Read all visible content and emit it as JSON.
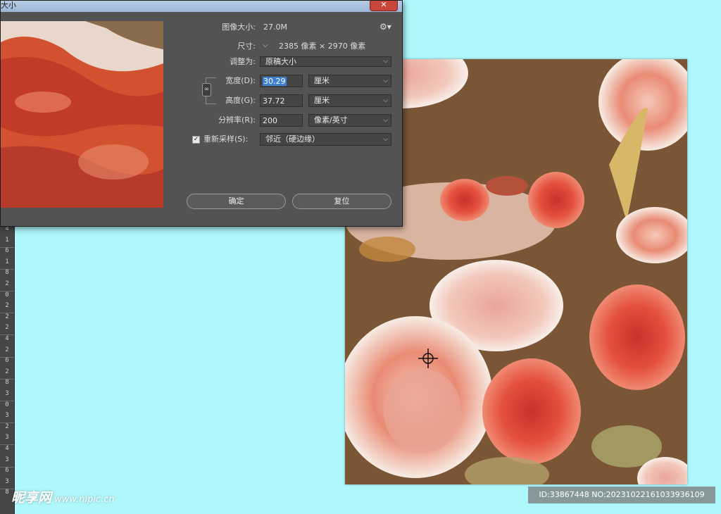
{
  "window": {
    "title": "大小",
    "close_label": "✕"
  },
  "dialog": {
    "image_size_label": "图像大小:",
    "image_size_value": "27.0M",
    "dimensions_label": "尺寸:",
    "dimensions_value": "2385 像素 × 2970 像素",
    "fit_label": "调整为:",
    "fit_value": "原稿大小",
    "width_label": "宽度(D):",
    "width_value": "30.29",
    "width_unit": "厘米",
    "height_label": "高度(G):",
    "height_value": "37.72",
    "height_unit": "厘米",
    "resolution_label": "分辨率(R):",
    "resolution_value": "200",
    "resolution_unit": "像素/英寸",
    "resample_label": "重新采样(S):",
    "resample_value": "邻近（硬边缘）",
    "ok_label": "确定",
    "reset_label": "复位"
  },
  "ruler": {
    "ticks": [
      "4",
      "1",
      "6",
      "1",
      "8",
      "2",
      "0",
      "2",
      "2",
      "2",
      "4",
      "2",
      "6",
      "2",
      "8",
      "3",
      "0",
      "3",
      "2",
      "3",
      "4",
      "3",
      "6",
      "3",
      "8"
    ]
  },
  "watermark": {
    "brand": "昵享网",
    "url": "www.nipic.cn"
  },
  "id_bar": "ID:33867448 NO:20231022161033936109",
  "colors": {
    "dialog_bg": "#535353",
    "canvas_bg": "#7a5536",
    "workspace": "#aef7fb",
    "accent_select": "#3d7fd1"
  }
}
